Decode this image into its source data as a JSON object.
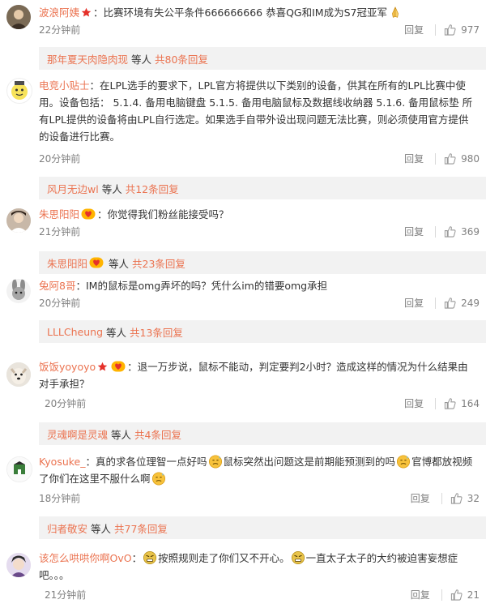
{
  "comments": [
    {
      "user": "波浪阿姨",
      "sep": "：",
      "text": "比赛环境有失公平条件666666666 恭喜QG和IM成为S7冠亚军",
      "time": "22分钟前",
      "reply": "回复",
      "likes": "977",
      "thread": {
        "who": "那年夏天肉隐肉现",
        "mid": "等人",
        "count": "共80条回复"
      }
    },
    {
      "user": "电竞小贴士",
      "sep": "：",
      "text": "在LPL选手的要求下，LPL官方将提供以下类别的设备，供其在所有的LPL比赛中使用。设备包括：  5.1.4. 备用电脑键盘   5.1.5. 备用电脑鼠标及数据线收纳器   5.1.6. 备用鼠标垫  所有LPL提供的设备将由LPL自行选定。如果选手自带外设出现问题无法比赛，则必须使用官方提供的设备进行比赛。",
      "time": "20分钟前",
      "reply": "回复",
      "likes": "980",
      "thread": {
        "who": "风月无边wl",
        "mid": "等人",
        "count": "共12条回复"
      }
    },
    {
      "user": "朱思阳阳",
      "sep": "：",
      "text": "你觉得我们粉丝能接受吗？",
      "time": "21分钟前",
      "reply": "回复",
      "likes": "369",
      "thread": {
        "who": "朱思阳阳",
        "mid": "等人",
        "count": "共23条回复"
      }
    },
    {
      "user": "兔阿8哥",
      "sep": "：",
      "text": "IM的鼠标是omg弄坏的吗？凭什么im的错要omg承担",
      "time": "20分钟前",
      "reply": "回复",
      "likes": "249",
      "thread": {
        "who": "LLLCheung",
        "mid": "等人",
        "count": "共13条回复"
      }
    },
    {
      "user": "饭饭yoyoyo",
      "sep": "：",
      "text": "退一万步说，鼠标不能动，判定要判2小时？造成这样的情况为什么结果由对手承担？",
      "time": "20分钟前",
      "reply": "回复",
      "likes": "164",
      "thread": {
        "who": "灵魂啊是灵魂",
        "mid": "等人",
        "count": "共4条回复"
      }
    },
    {
      "user": "Kyosuke_",
      "sep": "：",
      "text1": "真的求各位理智一点好吗",
      "text2": "鼠标突然出问题这是前期能预测到的吗",
      "text3": "官博都放视频了你们在这里不服什么啊",
      "time": "18分钟前",
      "reply": "回复",
      "likes": "32",
      "thread": {
        "who": "归者敬安",
        "mid": "等人",
        "count": "共77条回复"
      }
    },
    {
      "user": "该怎么哄哄你啊OvO",
      "sep": "：",
      "text1": "按照规则走了你们又不开心。",
      "text2": "一直太子太子的大约被迫害妄想症吧。。。",
      "time": "21分钟前",
      "reply": "回复",
      "likes": "21"
    }
  ],
  "icons": {
    "like": "thumbs-up-icon",
    "badge_vip": "red-star-icon",
    "badge_fan": "heart-badge-icon",
    "emoji_pray": "pray-emoji",
    "emoji_sweat": "sweat-emoji",
    "emoji_angry": "angry-emoji"
  },
  "colors": {
    "username": "#eb7350",
    "meta": "#808080",
    "thread_bg": "#f2f2f2"
  }
}
